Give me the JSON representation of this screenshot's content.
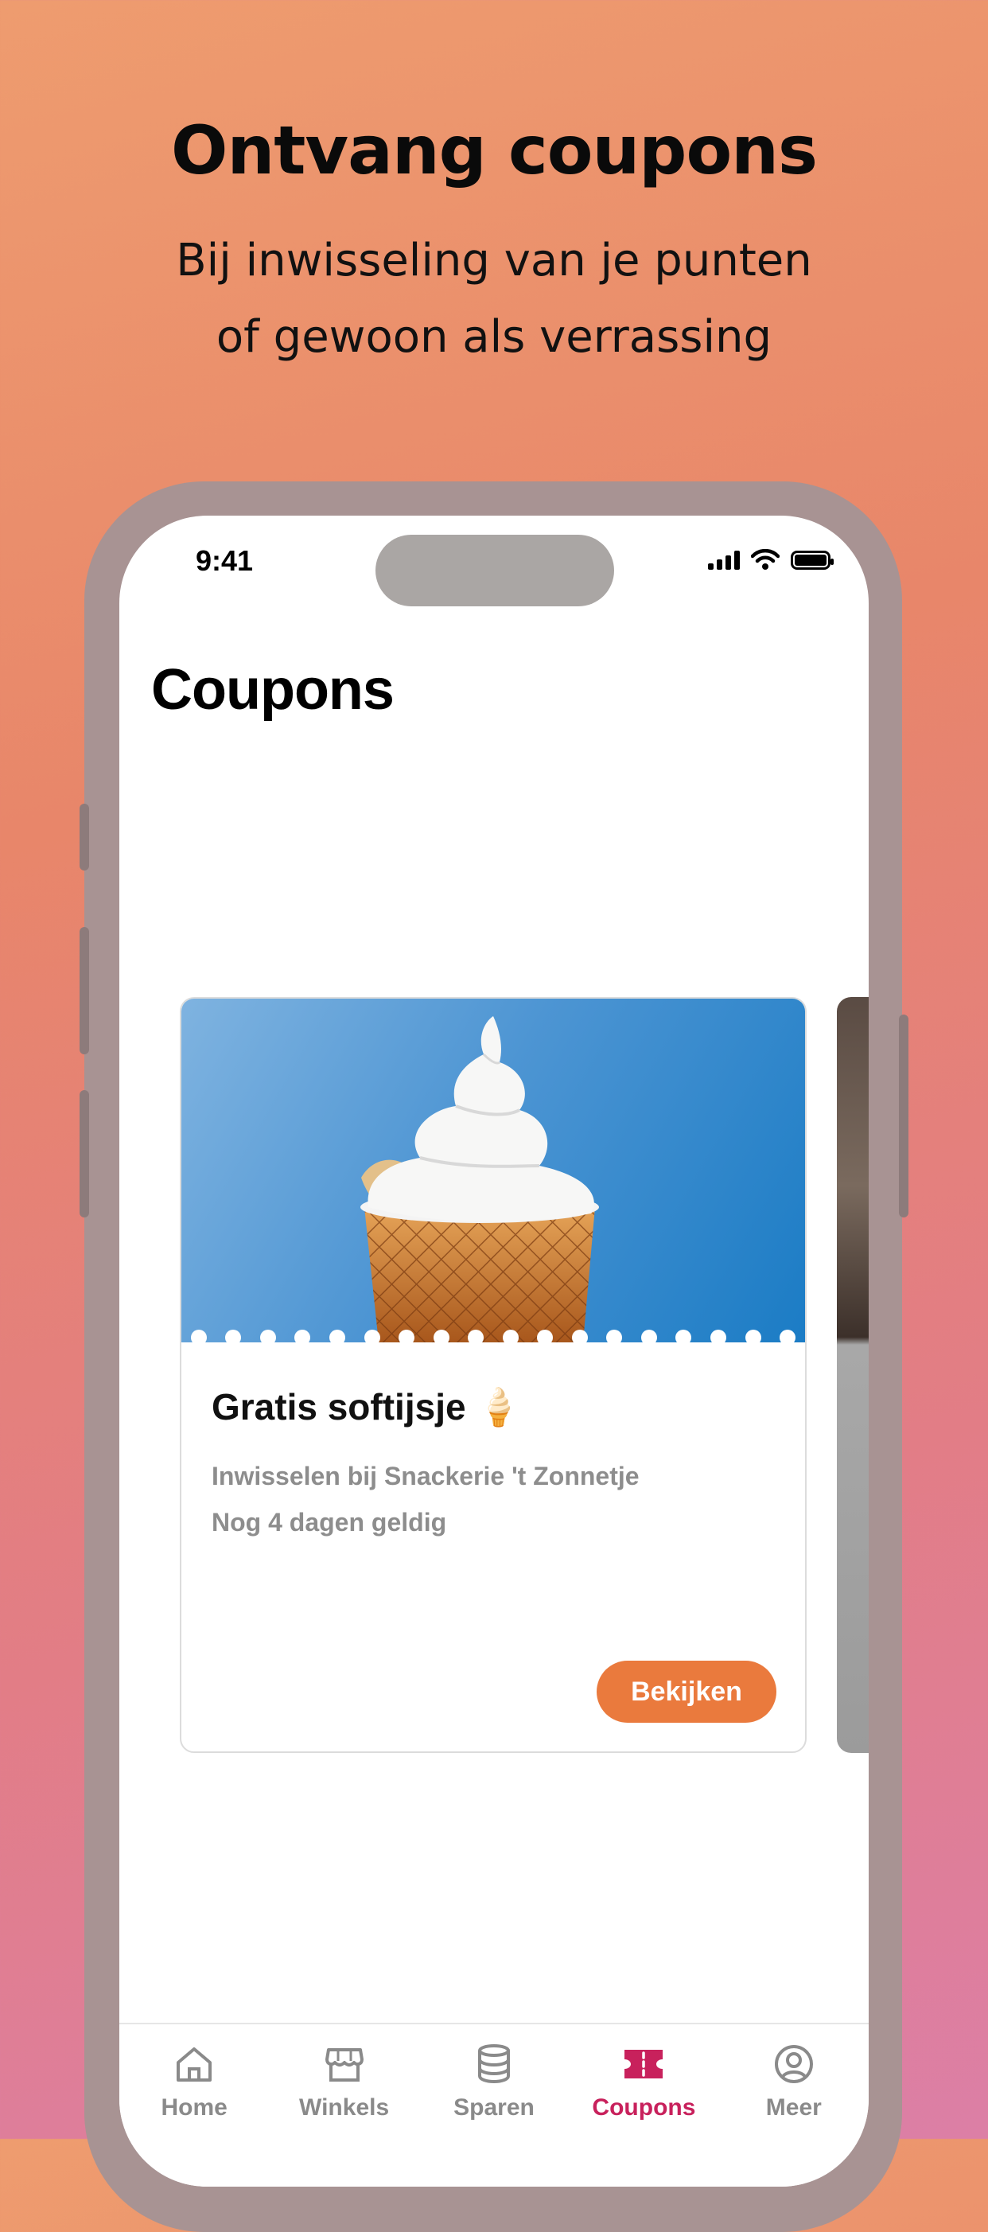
{
  "promo": {
    "title": "Ontvang coupons",
    "subtitle_line1": "Bij inwisseling van je punten",
    "subtitle_line2": "of gewoon als verrassing"
  },
  "status_bar": {
    "time": "9:41"
  },
  "page": {
    "title": "Coupons"
  },
  "coupon": {
    "title": "Gratis softijsje 🍦",
    "location": "Inwisselen bij Snackerie 't Zonnetje",
    "validity": "Nog 4 dagen geldig",
    "button_label": "Bekijken",
    "button_color": "#ea7a3d"
  },
  "tab_bar": {
    "active_color": "#c8215c",
    "items": [
      {
        "label": "Home",
        "icon": "home-icon"
      },
      {
        "label": "Winkels",
        "icon": "store-icon"
      },
      {
        "label": "Sparen",
        "icon": "coins-icon"
      },
      {
        "label": "Coupons",
        "icon": "ticket-icon",
        "active": true
      },
      {
        "label": "Meer",
        "icon": "user-circle-icon"
      }
    ]
  }
}
